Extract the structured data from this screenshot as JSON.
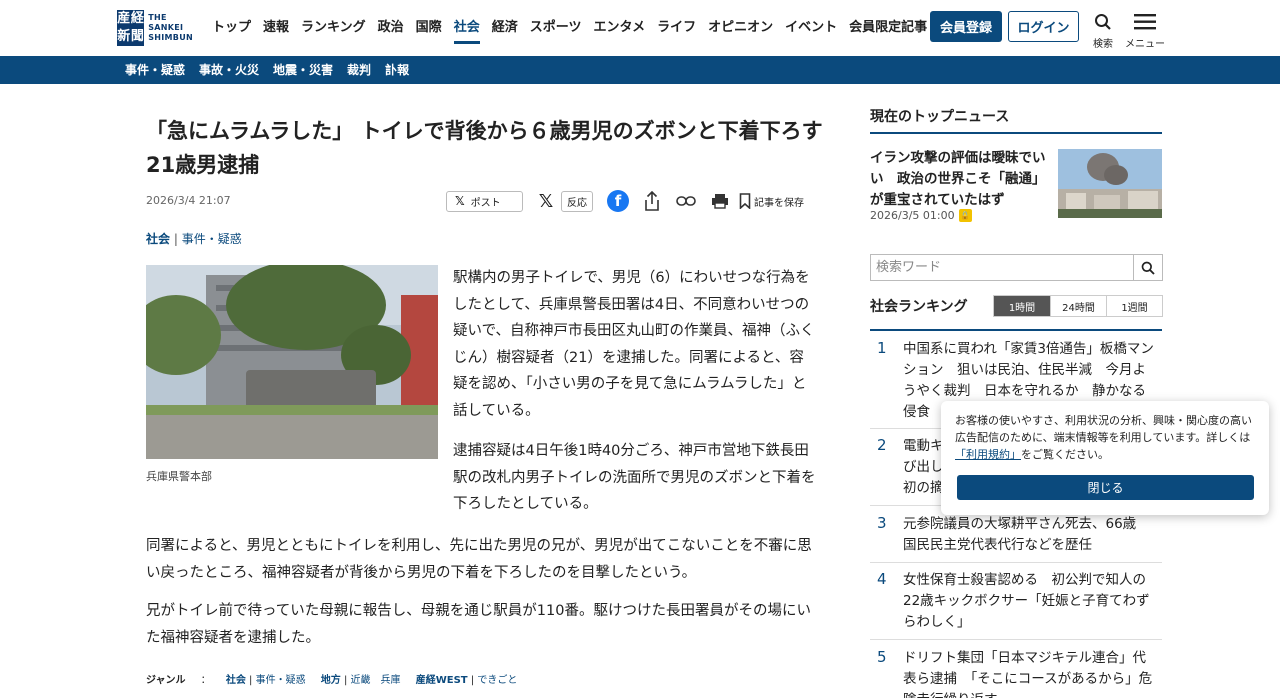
{
  "header": {
    "logo": {
      "mark": [
        "産",
        "経",
        "新",
        "聞"
      ],
      "text": [
        "THE",
        "SANKEI",
        "SHIMBUN"
      ]
    },
    "nav": [
      "トップ",
      "速報",
      "ランキング",
      "政治",
      "国際",
      "社会",
      "経済",
      "スポーツ",
      "エンタメ",
      "ライフ",
      "オピニオン",
      "イベント",
      "会員限定記事"
    ],
    "active_nav": "社会",
    "register_label": "会員登録",
    "login_label": "ログイン",
    "search_label": "検索",
    "menu_label": "メニュー"
  },
  "subnav": [
    "事件・疑惑",
    "事故・火災",
    "地震・災害",
    "裁判",
    "訃報"
  ],
  "article": {
    "headline": "「急にムラムラした」 トイレで背後から６歳男児のズボンと下着下ろす　21歳男逮捕",
    "date": "2026/3/4 21:07",
    "share": {
      "post": "ポスト",
      "react": "反応",
      "save": "記事を保存"
    },
    "category_main": "社会",
    "category_sub": "事件・疑惑",
    "photo_caption": "兵庫県警本部",
    "paragraphs": [
      "駅構内の男子トイレで、男児（6）にわいせつな行為をしたとして、兵庫県警長田署は4日、不同意わいせつの疑いで、自称神戸市長田区丸山町の作業員、福神（ふくじん）樹容疑者（21）を逮捕した。同署によると、容疑を認め、「小さい男の子を見て急にムラムラした」と話している。",
      "逮捕容疑は4日午後1時40分ごろ、神戸市営地下鉄長田駅の改札内男子トイレの洗面所で男児のズボンと下着を下ろしたとしている。",
      "同署によると、男児とともにトイレを利用し、先に出た男児の兄が、男児が出てこないことを不審に思い戻ったところ、福神容疑者が背後から男児の下着を下ろしたのを目撃したという。",
      "兄がトイレ前で待っていた母親に報告し、母親を通じ駅員が110番。駆けつけた長田署員がその場にいた福神容疑者を逮捕した。"
    ],
    "genre": {
      "label": "ジャンル",
      "colon": "：",
      "items": [
        {
          "main": "社会",
          "sub": "事件・疑惑"
        },
        {
          "main": "地方",
          "sub": "近畿　兵庫"
        },
        {
          "main": "産経WEST",
          "sub": "できごと"
        }
      ]
    }
  },
  "sidebar": {
    "top_news_title": "現在のトップニュース",
    "top_news": {
      "title": "イラン攻撃の評価は曖昧でいい　政治の世界こそ「融通」が重宝されていたはず",
      "date": "2026/3/5 01:00"
    },
    "search_placeholder": "検索ワード",
    "ranking_title": "社会ランキング",
    "ranking_tabs": [
      "1時間",
      "24時間",
      "1週間"
    ],
    "ranking_active": "1時間",
    "ranking": [
      {
        "num": "1",
        "text": "中国系に買われ「家賃3倍通告」板橋マンション　狙いは民泊、住民半減　今月ようやく裁判　日本を守れるか　静かなる侵食"
      },
      {
        "num": "2",
        "text": "電動キ…び出し…初の摘…"
      },
      {
        "num": "3",
        "text": "元参院議員の大塚耕平さん死去、66歳　国民民主党代表代行などを歴任"
      },
      {
        "num": "4",
        "text": "女性保育士殺害認める　初公判で知人の22歳キックボクサー「妊娠と子育てわずらわしく」"
      },
      {
        "num": "5",
        "text": "ドリフト集団「日本マジキテル連合」代表ら逮捕　「そこにコースがあるから」危険走行繰り返す"
      }
    ]
  },
  "cookie": {
    "text_before": "お客様の使いやすさ、利用状況の分析、興味・関心度の高い広告配信のために、端末情報等を利用しています。詳しくは",
    "terms_link": "「利用規約」",
    "text_after": "をご覧ください。",
    "close_label": "閉じる"
  },
  "colors": {
    "brand": "#0b4a7d",
    "facebook": "#1877f2",
    "lock": "#f2c200"
  }
}
